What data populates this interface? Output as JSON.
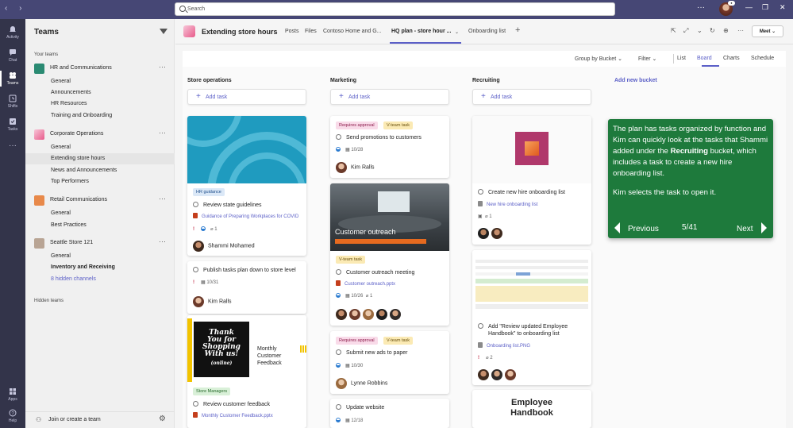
{
  "titlebar": {
    "search_placeholder": "Search"
  },
  "rail": [
    {
      "label": "Activity",
      "icon": "bell-icon"
    },
    {
      "label": "Chat",
      "icon": "chat-icon"
    },
    {
      "label": "Teams",
      "icon": "teams-icon"
    },
    {
      "label": "Shifts",
      "icon": "clock-icon"
    },
    {
      "label": "Tasks",
      "icon": "tasks-icon"
    },
    {
      "label": "",
      "icon": "more-icon"
    },
    {
      "label": "Apps",
      "icon": "apps-icon"
    },
    {
      "label": "Help",
      "icon": "help-icon"
    }
  ],
  "sidebar": {
    "title": "Teams",
    "your_teams": "Your teams",
    "hidden_teams": "Hidden teams",
    "join": "Join or create a team",
    "teams": [
      {
        "name": "HR and Communications",
        "channels": [
          "General",
          "Announcements",
          "HR Resources",
          "Training and Onboarding"
        ]
      },
      {
        "name": "Corporate Operations",
        "channels": [
          "General",
          "Extending store hours",
          "News and Announcements",
          "Top Performers"
        ]
      },
      {
        "name": "Retail Communications",
        "channels": [
          "General",
          "Best Practices"
        ]
      },
      {
        "name": "Seattle Store 121",
        "channels": [
          "General",
          "Inventory and Receiving",
          "8 hidden channels"
        ]
      }
    ]
  },
  "header": {
    "title": "Extending store hours",
    "tabs": [
      "Posts",
      "Files",
      "Contoso Home and G...",
      "HQ plan - store hour ...",
      "Onboarding list"
    ],
    "meet": "Meet"
  },
  "toolbar": {
    "group_by": "Group by Bucket",
    "filter": "Filter",
    "views": [
      "List",
      "Board",
      "Charts",
      "Schedule"
    ]
  },
  "board": {
    "buckets": [
      "Store operations",
      "Marketing",
      "Recruiting"
    ],
    "add_task": "Add task",
    "add_bucket": "Add new bucket",
    "store_ops": {
      "c1_label": "HR guidance",
      "c1_title": "Review state guidelines",
      "c1_attach": "Guidance of Preparing Workplaces for COVID",
      "c1_meta": "1",
      "c1_person": "Shammi Mohamed",
      "c2_title": "Publish tasks plan down to store level",
      "c2_meta": "10/31",
      "c2_person": "Kim Ralls",
      "c3_img_line1": "Thank",
      "c3_img_line2": "You for",
      "c3_img_line3": "Shopping",
      "c3_img_line4": "With us!",
      "c3_img_line5": "(online)",
      "c3_side1": "Monthly",
      "c3_side2": "Customer",
      "c3_side3": "Feedback",
      "c3_label": "Store Managers",
      "c3_title": "Review customer feedback",
      "c3_attach": "Monthly Customer Feedback.pptx"
    },
    "marketing": {
      "c1_label1": "Requires approval",
      "c1_label2": "V-team task",
      "c1_title": "Send promotions to customers",
      "c1_meta": "10/28",
      "c1_person": "Kim Ralls",
      "c2_img_title": "Customer outreach",
      "c2_label": "V-team task",
      "c2_title": "Customer outreach meeting",
      "c2_attach": "Customer outreach.pptx",
      "c2_meta": "10/26",
      "c2_meta2": "1",
      "c3_label1": "Requires approval",
      "c3_label2": "V-team task",
      "c3_title": "Submit new ads to paper",
      "c3_meta": "10/30",
      "c3_person": "Lynne Robbins",
      "c4_title": "Update website",
      "c4_meta": "12/18"
    },
    "recruiting": {
      "c1_title": "Create new hire onboarding list",
      "c1_attach": "New hire onboarding list",
      "c1_meta": "1",
      "c2_title": "Add \"Review updated Employee Handbook\" to onboarding list",
      "c2_attach": "Onboarding list.PNG",
      "c2_meta": "2",
      "c3_img_line1": "Employee",
      "c3_img_line2": "Handbook"
    }
  },
  "tooltip": {
    "p1_a": "The plan has tasks organized by function and Kim can quickly look at the tasks that Shammi added under the ",
    "p1_bold": "Recruiting",
    "p1_b": " bucket, which includes a task to create a new hire onboarding list.",
    "p2": "Kim selects the task to open it.",
    "prev": "Previous",
    "count": "5/41",
    "next": "Next"
  },
  "colors": {
    "accent": "#5b5fc7",
    "rail": "#33344a",
    "titlebar": "#464775",
    "tooltip": "#1e7a3c"
  }
}
